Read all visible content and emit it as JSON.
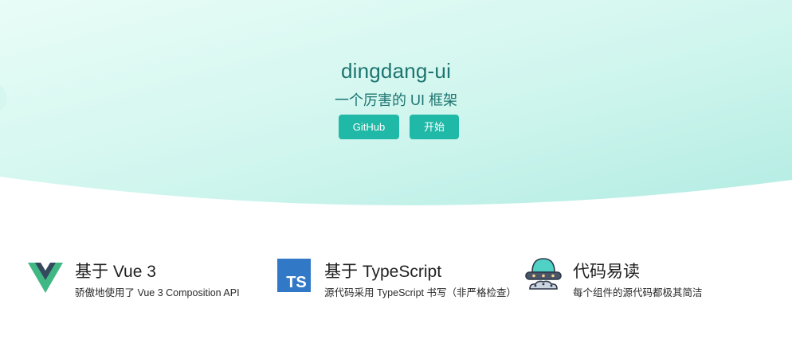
{
  "hero": {
    "title": "dingdang-ui",
    "subtitle": "一个厉害的 UI 框架",
    "github_label": "GitHub",
    "start_label": "开始"
  },
  "features": [
    {
      "icon": "vue-logo-icon",
      "title": "基于 Vue 3",
      "desc": "骄傲地使用了 Vue 3 Composition API"
    },
    {
      "icon": "typescript-logo-icon",
      "title": "基于 TypeScript",
      "desc": "源代码采用 TypeScript 书写（非严格检查）",
      "icon_text": "TS"
    },
    {
      "icon": "ufo-icon",
      "title": "代码易读",
      "desc": "每个组件的源代码都极其简洁"
    }
  ],
  "colors": {
    "accent": "#20b8a6",
    "hero_text": "#1d7470",
    "hero_bg_start": "#e6fbf6",
    "hero_bg_end": "#b5eee6",
    "vue_green": "#41b883",
    "vue_dark": "#34495e",
    "ts_blue": "#3178c6"
  }
}
